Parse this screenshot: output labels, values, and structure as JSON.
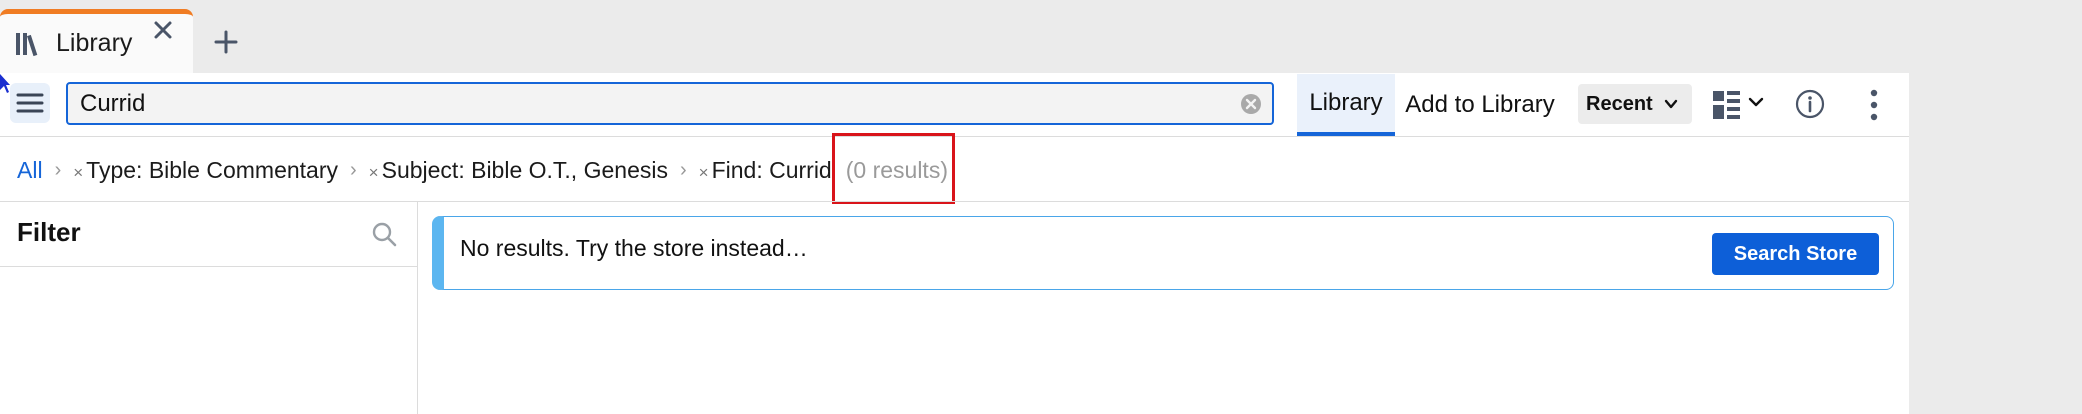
{
  "tab": {
    "title": "Library"
  },
  "search": {
    "value": "Currid"
  },
  "view_tabs": {
    "library": "Library",
    "add_to_library": "Add to Library"
  },
  "sort": {
    "selected": "Recent"
  },
  "breadcrumb": {
    "all": "All",
    "filters": [
      {
        "label": "Type: Bible Commentary"
      },
      {
        "label": "Subject: Bible O.T., Genesis"
      },
      {
        "label": "Find: Currid"
      }
    ],
    "results": "(0 results)"
  },
  "filter_panel": {
    "title": "Filter"
  },
  "message": {
    "text": "No results. Try the store instead…",
    "button": "Search Store"
  },
  "colors": {
    "accent": "#1565d8",
    "tab_accent": "#f07c23",
    "highlight": "#d9141a",
    "info_border": "#4aa6e9"
  },
  "icons": [
    "library-icon",
    "close-icon",
    "plus-icon",
    "hamburger-icon",
    "clear-icon",
    "chevron-down-icon",
    "layout-icon",
    "info-icon",
    "more-vertical-icon",
    "search-icon"
  ]
}
